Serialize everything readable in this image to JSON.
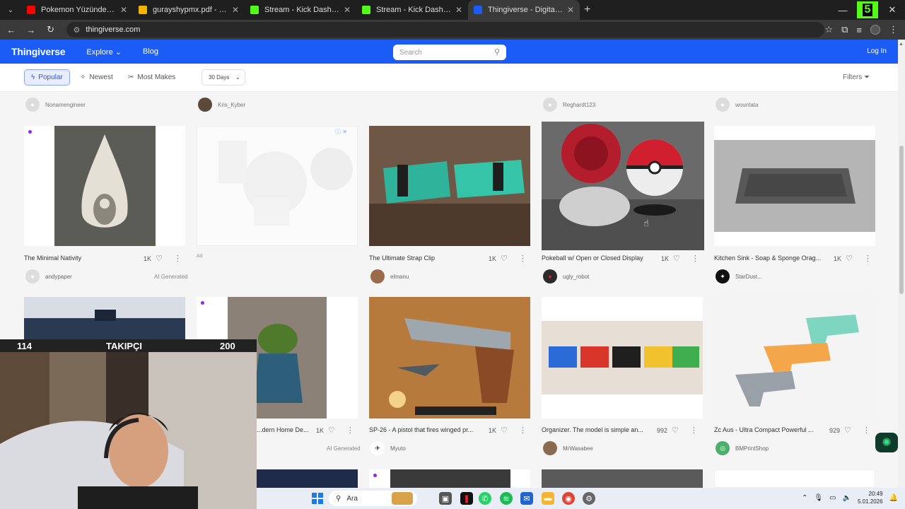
{
  "browser": {
    "tabs": [
      {
        "title": "Pokemon Yüzünden EVİMİ POL",
        "color": "#ff0000"
      },
      {
        "title": "gurayshypmx.pdf - Google Driv",
        "color": "#f4b400"
      },
      {
        "title": "Stream - Kick Dashboard",
        "color": "#53fc18"
      },
      {
        "title": "Stream - Kick Dashboard",
        "color": "#53fc18"
      },
      {
        "title": "Thingiverse - Digital Designs fo",
        "color": "#1b5cf7",
        "active": true
      }
    ],
    "url": "thingiverse.com",
    "kick_badge": "5"
  },
  "site": {
    "logo": "Thingiverse",
    "explore": "Explore",
    "blog": "Blog",
    "search_placeholder": "Search",
    "login": "Log In",
    "accent": "#1b5cf7"
  },
  "filters": {
    "popular": "Popular",
    "newest": "Newest",
    "most_makes": "Most Makes",
    "range": "30 Days",
    "filters_label": "Filters"
  },
  "top_users": [
    "Nonamengineer",
    "Kris_Kyber",
    "Reghardt123",
    "wountata"
  ],
  "row1": [
    {
      "title": "The Minimal Nativity",
      "count": "1K",
      "user": "andypaper",
      "tag": "AI Generated"
    },
    {
      "title": "",
      "ad": "Ad"
    },
    {
      "title": "The Ultimate Strap Clip",
      "count": "1K",
      "user": "elmanu"
    },
    {
      "title": "Pokeball w/ Open or Closed Display",
      "count": "1K",
      "user": "ugly_robot"
    },
    {
      "title": "Kitchen Sink - Soap & Sponge Orag...",
      "count": "1K",
      "user": "StarDust..."
    }
  ],
  "row2": [
    {
      "title": "",
      "count": ""
    },
    {
      "title": "...dern Home De...",
      "count": "1K",
      "tag": "AI Generated"
    },
    {
      "title": "SP-26 - A pistol that fires winged pr...",
      "count": "1K",
      "user": "Myuto"
    },
    {
      "title": "Organizer. The model is simple an...",
      "count": "992",
      "user": "MrWasabee"
    },
    {
      "title": "Zc Aus - Ultra Compact Powerful ...",
      "count": "929",
      "user": "BMPrintShop"
    }
  ],
  "webcam": {
    "left": "114",
    "label": "TAKIPÇI",
    "right": "200"
  },
  "taskbar": {
    "search": "Ara",
    "time": "20:49",
    "date": "5.01.2026"
  }
}
